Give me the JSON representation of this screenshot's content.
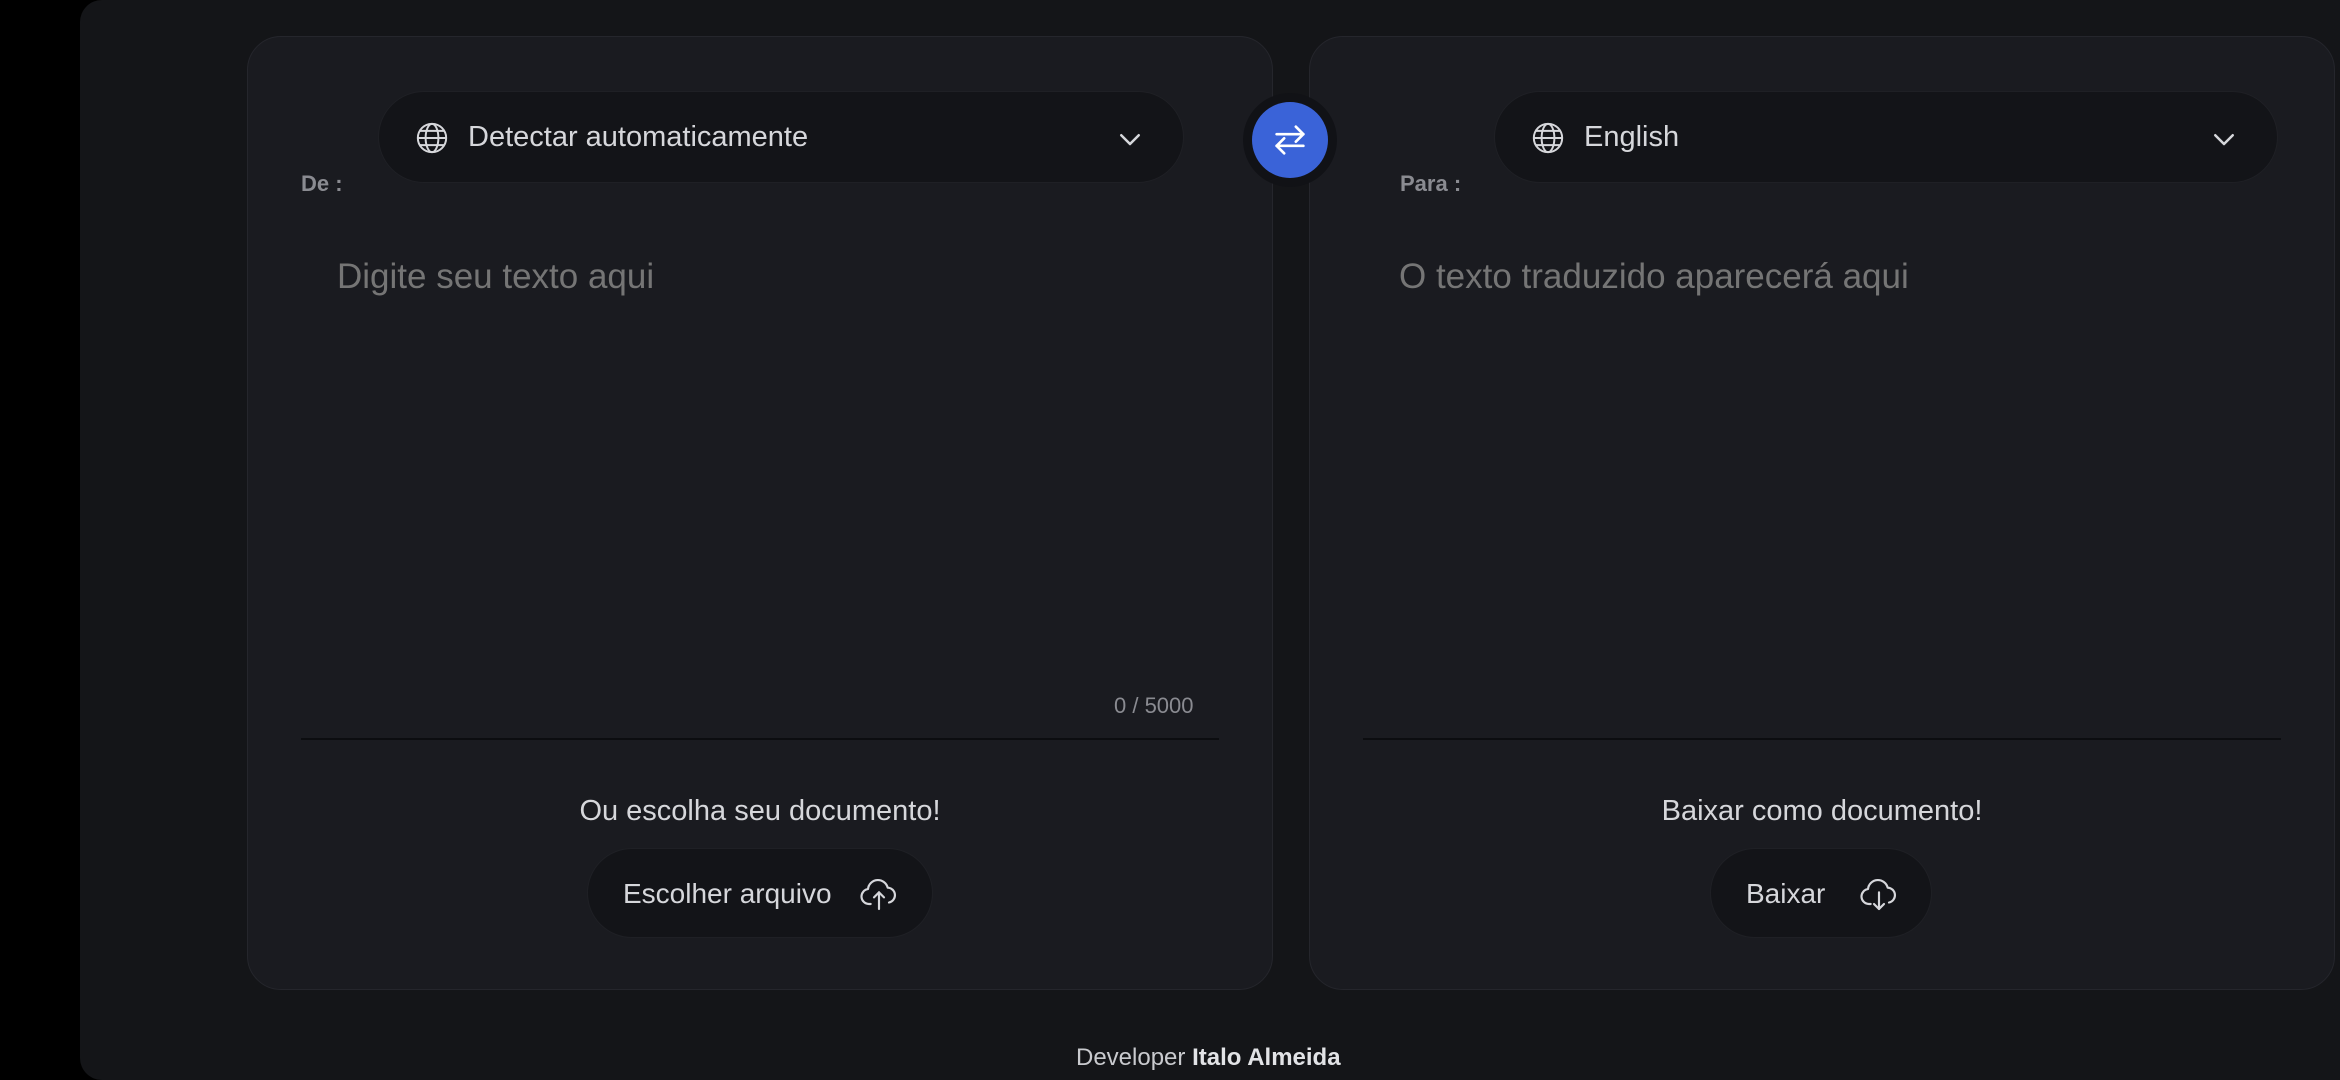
{
  "source_panel": {
    "label": "De :",
    "language": "Detectar automaticamente",
    "text_placeholder": "Digite seu texto aqui",
    "char_counter": "0 / 5000",
    "document_caption": "Ou escolha seu documento!",
    "document_button": "Escolher arquivo"
  },
  "target_panel": {
    "label": "Para :",
    "language": "English",
    "text_placeholder": "O texto traduzido aparecerá aqui",
    "document_caption": "Baixar como documento!",
    "document_button": "Baixar"
  },
  "footer": {
    "prefix": "Developer",
    "author": "Italo Almeida"
  },
  "icons": {
    "language_select": "globe-icon",
    "dropdown": "chevron-down-icon",
    "swap": "swap-arrows-icon",
    "upload": "cloud-upload-icon",
    "download": "cloud-download-icon"
  },
  "colors": {
    "accent": "#3a63d8",
    "panel_background": "#1a1b20",
    "page_background": "#141518",
    "control_background": "#131418"
  }
}
